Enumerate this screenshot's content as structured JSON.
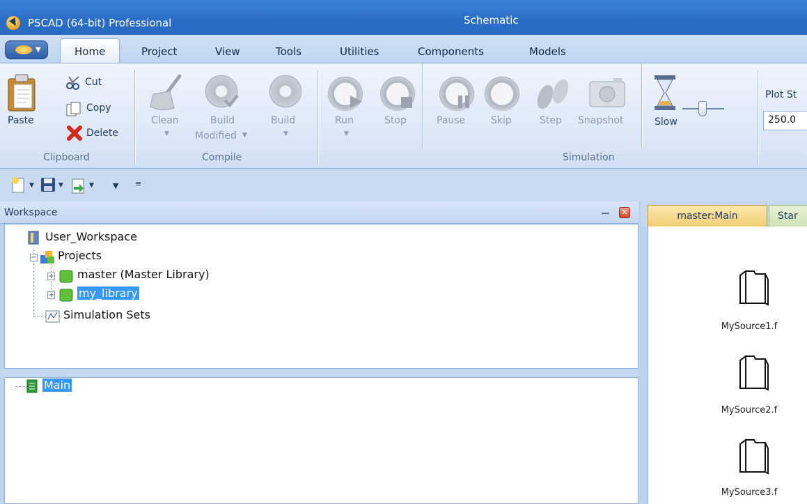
{
  "titlebar": {
    "app_title": "PSCAD (64-bit) Professional",
    "center_title": "Schematic",
    "app_icon": "pscad-logo-icon"
  },
  "ribbon_tabs": [
    "Home",
    "Project",
    "View",
    "Tools",
    "Utilities",
    "Components",
    "Models"
  ],
  "clipboard": {
    "paste": "Paste",
    "cut": "Cut",
    "copy": "Copy",
    "delete": "Delete",
    "group": "Clipboard"
  },
  "compile": {
    "clean": "Clean",
    "build_modified_1": "Build",
    "build_modified_2": "Modified",
    "build": "Build",
    "group": "Compile"
  },
  "simulation": {
    "run": "Run",
    "stop": "Stop",
    "pause": "Pause",
    "skip": "Skip",
    "step": "Step",
    "snapshot": "Snapshot",
    "slow": "Slow",
    "group": "Simulation"
  },
  "plot": {
    "label": "Plot St",
    "value": "250.0"
  },
  "workspace": {
    "title": "Workspace",
    "pin": "📌",
    "close": "x",
    "tree": {
      "root": "User_Workspace",
      "projects": "Projects",
      "master": "master (Master Library)",
      "my_library": "my_library",
      "simulation_sets": "Simulation Sets"
    },
    "lower_tree": {
      "main": "Main"
    }
  },
  "doc_tabs": {
    "active": "master:Main",
    "next": "Star"
  },
  "modules": [
    {
      "label": "MySource1.f"
    },
    {
      "label": "MySource2.f"
    },
    {
      "label": "MySource3.f"
    }
  ],
  "colors": {
    "titlebar": "#2b6dc4",
    "ribbon": "#dce8f7",
    "selection": "#3399ff",
    "active_doc_tab": "#f7d98b"
  }
}
